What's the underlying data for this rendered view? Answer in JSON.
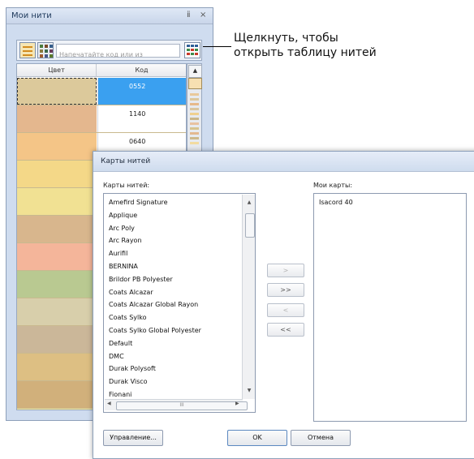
{
  "panel": {
    "title": "Мои нити",
    "pin_glyph": "ⅱ",
    "close_glyph": "×",
    "search_placeholder": "Напечатайте код или из",
    "columns": {
      "color": "Цвет",
      "code": "Код"
    },
    "rows": [
      {
        "color": "#dcc99b",
        "code": "0552",
        "selected": true
      },
      {
        "color": "#e4b78e",
        "code": "1140",
        "selected": false
      },
      {
        "color": "#f4c587",
        "code": "0640",
        "selected": false
      },
      {
        "color": "#f4d888",
        "code": "",
        "selected": false
      },
      {
        "color": "#f1e193",
        "code": "",
        "selected": false
      },
      {
        "color": "#d8b68d",
        "code": "",
        "selected": false
      },
      {
        "color": "#f4b59a",
        "code": "",
        "selected": false
      },
      {
        "color": "#b9c991",
        "code": "",
        "selected": false
      },
      {
        "color": "#d8cfab",
        "code": "",
        "selected": false
      },
      {
        "color": "#cbb799",
        "code": "",
        "selected": false
      },
      {
        "color": "#ddbf83",
        "code": "",
        "selected": false
      },
      {
        "color": "#d1b07b",
        "code": "",
        "selected": false
      },
      {
        "color": "#f6ea9a",
        "code": "",
        "selected": false
      }
    ]
  },
  "callout": {
    "text": "Щелкнуть, чтобы открыть таблицу нитей"
  },
  "dialog": {
    "title": "Карты нитей",
    "left_label": "Карты нитей:",
    "right_label": "Мои карты:",
    "thread_charts": [
      "Amefird Signature",
      "Applique",
      "Arc Poly",
      "Arc Rayon",
      "Aurifil",
      "BERNINA",
      "Brildor PB Polyester",
      "Coats Alcazar",
      "Coats Alcazar Global Rayon",
      "Coats Sylko",
      "Coats Sylko Global Polyester",
      "Default",
      "DMC",
      "Durak Polysoft",
      "Durak Visco",
      "Fionani"
    ],
    "my_charts": [
      "Isacord 40"
    ],
    "transfer_buttons": [
      ">",
      ">>",
      "<",
      "<<"
    ],
    "hscroll_grip": "III",
    "manage_label": "Управление...",
    "ok_label": "OK",
    "cancel_label": "Отмена"
  }
}
